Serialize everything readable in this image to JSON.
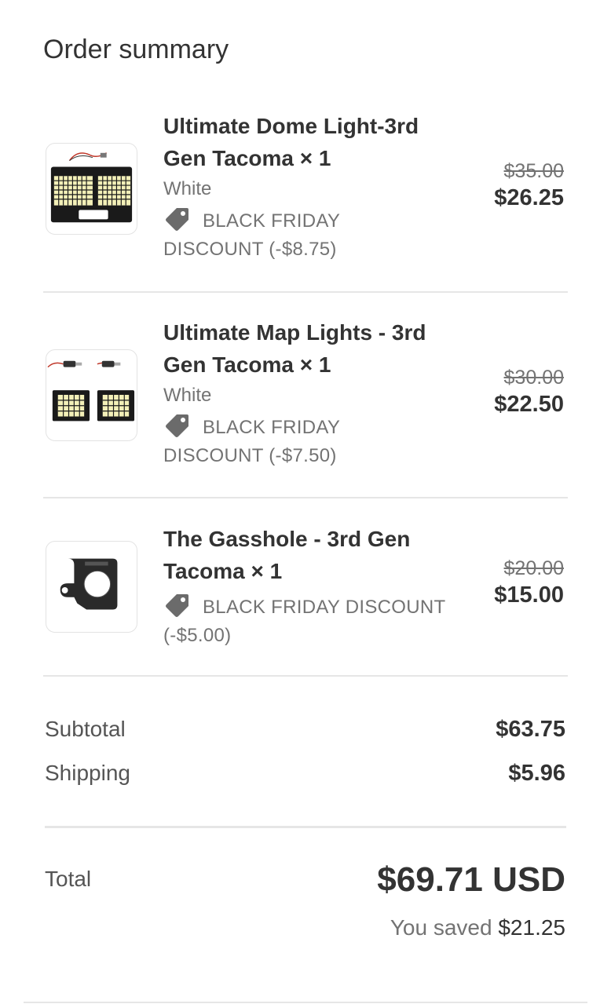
{
  "header": {
    "title": "Order summary"
  },
  "items": [
    {
      "name_line1": "Ultimate Dome Light-3rd",
      "name_line2": "Gen Tacoma × 1",
      "variant": "White",
      "discount_line1": "BLACK FRIDAY",
      "discount_line2": "DISCOUNT (-$8.75)",
      "original_price": "$35.00",
      "final_price": "$26.25",
      "image_icon": "dome-light-product-image"
    },
    {
      "name_line1": "Ultimate Map Lights - 3rd",
      "name_line2": "Gen Tacoma × 1",
      "variant": "White",
      "discount_line1": "BLACK FRIDAY",
      "discount_line2": "DISCOUNT (-$7.50)",
      "original_price": "$30.00",
      "final_price": "$22.50",
      "image_icon": "map-lights-product-image"
    },
    {
      "name_line1": "The Gasshole - 3rd Gen",
      "name_line2": "Tacoma × 1",
      "variant": "",
      "discount_line1": "BLACK FRIDAY DISCOUNT",
      "discount_line2": "(-$5.00)",
      "original_price": "$20.00",
      "final_price": "$15.00",
      "image_icon": "gasshole-product-image"
    }
  ],
  "summary": {
    "subtotal_label": "Subtotal",
    "subtotal_value": "$63.75",
    "shipping_label": "Shipping",
    "shipping_value": "$5.96",
    "total_label": "Total",
    "total_value": "$69.71 USD",
    "saved_label": "You saved",
    "saved_value": "$21.25"
  },
  "colors": {
    "text_primary": "#333333",
    "text_secondary": "#737373",
    "divider": "#e6e6e6",
    "tag_icon": "#6b6b6b"
  }
}
